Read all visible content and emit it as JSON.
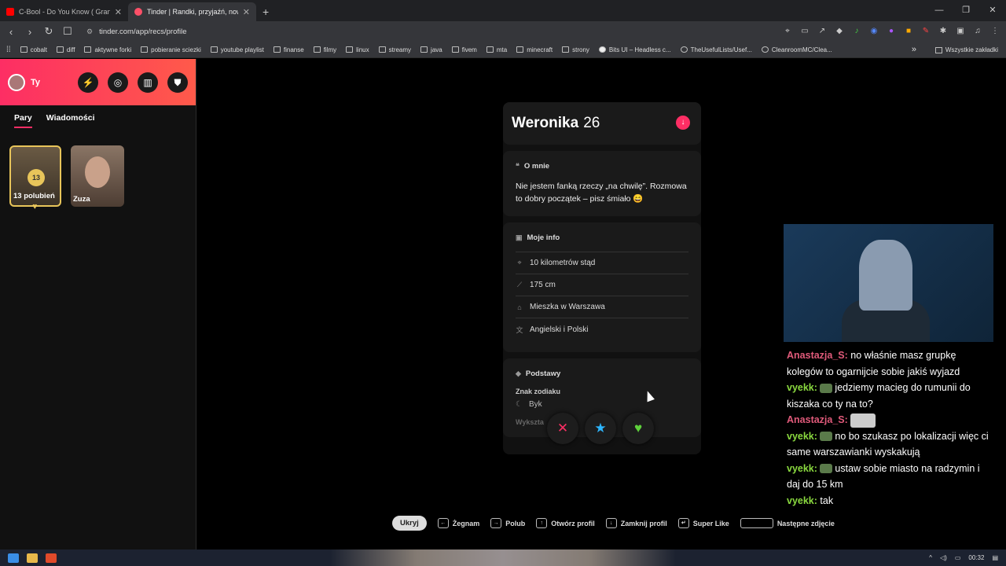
{
  "browser": {
    "tabs": [
      {
        "title": "C-Bool - Do You Know ( GranTi R",
        "active": false
      },
      {
        "title": "Tinder | Randki, przyjaźń, nowe ...",
        "active": true
      }
    ],
    "new_tab": "+",
    "url": "tinder.com/app/recs/profile",
    "bookmarks": [
      "cobalt",
      "diff",
      "aktywne forki",
      "pobieranie sciezki",
      "youtube playlist",
      "finanse",
      "filmy",
      "linux",
      "streamy",
      "java",
      "fivem",
      "mta",
      "minecraft",
      "strony",
      "Bits UI – Headless c...",
      "TheUsefulLists/Usef...",
      "CleanroomMC/Clea..."
    ],
    "bookmarks_more": "»",
    "all_bookmarks": "Wszystkie zakładki"
  },
  "sidebar": {
    "user_name": "Ty",
    "tabs": [
      "Pary",
      "Wiadomości"
    ],
    "likes_count": "13",
    "likes_label": "13 polubień",
    "match_name": "Zuza"
  },
  "profile": {
    "name": "Weronika",
    "age": "26",
    "about_title": "O mnie",
    "bio": "Nie jestem fanką rzeczy „na chwilę”. Rozmowa to dobry początek – pisz śmiało 😄",
    "info_title": "Moje info",
    "info": [
      {
        "icon": "location-icon",
        "text": "10 kilometrów stąd"
      },
      {
        "icon": "ruler-icon",
        "text": "175 cm"
      },
      {
        "icon": "home-icon",
        "text": "Mieszka w Warszawa"
      },
      {
        "icon": "language-icon",
        "text": "Angielski i Polski"
      }
    ],
    "basics_title": "Podstawy",
    "zodiac_label": "Znak zodiaku",
    "zodiac_value": "Byk",
    "education_label": "Wykszta"
  },
  "chat": [
    {
      "user": "Anastazja_S:",
      "type": "a",
      "msg": "no właśnie masz grupkę kolegów to ogarnijcie sobie jakiś wyjazd"
    },
    {
      "user": "vyekk:",
      "type": "v",
      "msg": "jedziemy macieg do rumunii do kiszaka co ty na to?"
    },
    {
      "user": "Anastazja_S:",
      "type": "a",
      "msg": ""
    },
    {
      "user": "vyekk:",
      "type": "v",
      "msg": "no bo szukasz po lokalizacji więc ci same warszawianki wyskakują"
    },
    {
      "user": "vyekk:",
      "type": "v",
      "msg": "ustaw sobie miasto na radzymin i daj do 15 km"
    },
    {
      "user": "vyekk:",
      "type": "v",
      "msg": "tak"
    }
  ],
  "shortcuts": {
    "hide": "Ukryj",
    "items": [
      "Żegnam",
      "Polub",
      "Otwórz profil",
      "Zamknij profil",
      "Super Like",
      "Następne zdjęcie"
    ]
  },
  "taskbar": {
    "time": "00:32"
  },
  "colors": {
    "tinder_accent": "#fd2e64",
    "chat_user_a": "#e05a7a",
    "chat_user_v": "#8ad93f"
  }
}
